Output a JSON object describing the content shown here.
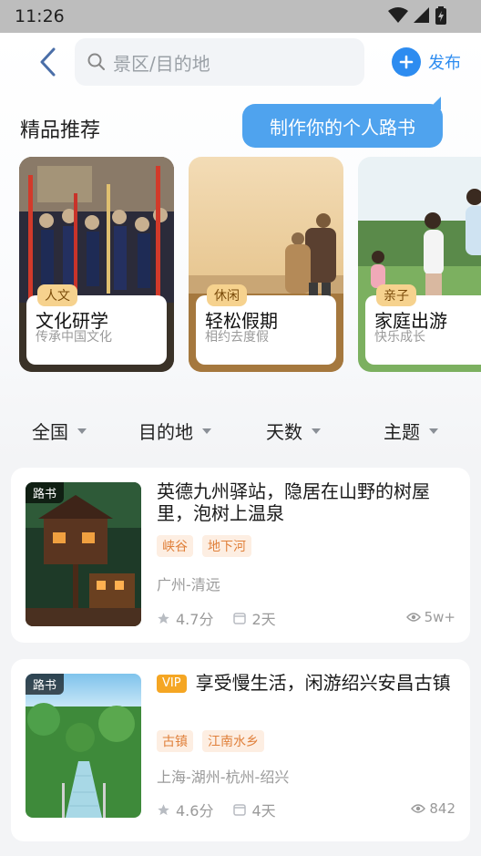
{
  "status_bar": {
    "time": "11:26"
  },
  "header": {
    "search_placeholder": "景区/目的地",
    "publish_label": "发布"
  },
  "tooltip": {
    "text": "制作你的个人路书"
  },
  "featured": {
    "title": "精品推荐",
    "cards": [
      {
        "tag": "人文",
        "title": "文化研学",
        "subtitle": "传承中国文化"
      },
      {
        "tag": "休闲",
        "title": "轻松假期",
        "subtitle": "相约去度假"
      },
      {
        "tag": "亲子",
        "title": "家庭出游",
        "subtitle": "快乐成长"
      }
    ]
  },
  "filters": [
    {
      "label": "全国"
    },
    {
      "label": "目的地"
    },
    {
      "label": "天数"
    },
    {
      "label": "主题"
    }
  ],
  "routes": [
    {
      "badge": "路书",
      "vip": "",
      "title": "英德九州驿站，隐居在山野的树屋里，泡树上温泉",
      "tags": [
        "峡谷",
        "地下河"
      ],
      "location": "广州-清远",
      "rating": "4.7分",
      "days": "2天",
      "views": "5w+"
    },
    {
      "badge": "路书",
      "vip": "VIP",
      "title": "享受慢生活，闲游绍兴安昌古镇",
      "tags": [
        "古镇",
        "江南水乡"
      ],
      "location": "上海-湖州-杭州-绍兴",
      "rating": "4.6分",
      "days": "4天",
      "views": "842"
    }
  ]
}
